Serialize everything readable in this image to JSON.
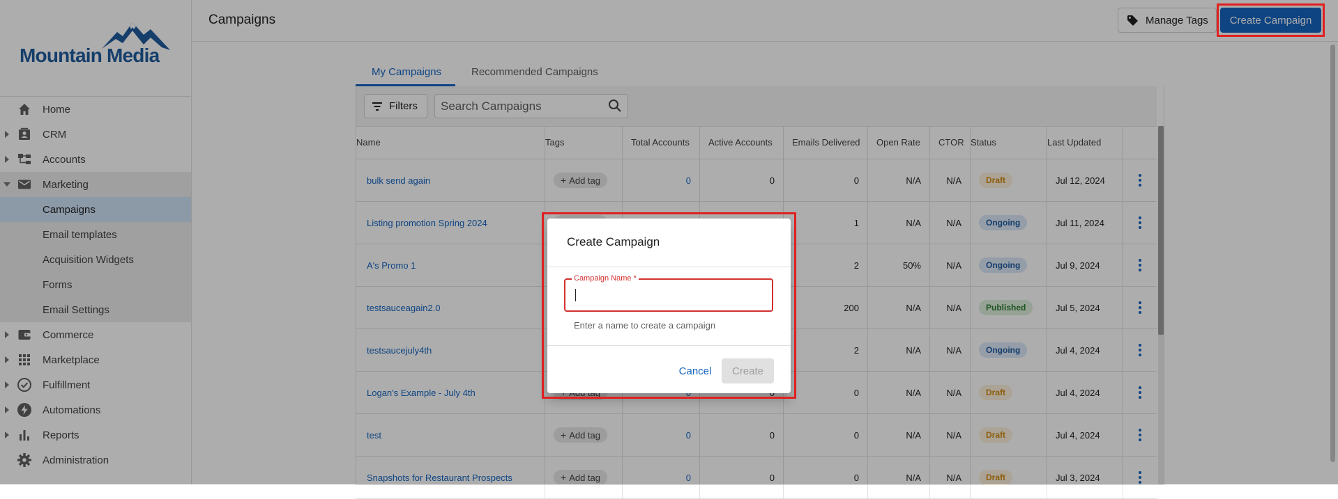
{
  "brand": {
    "logo_text": "Mountain Media",
    "color": "#1f5c9e"
  },
  "sidebar": {
    "items": [
      {
        "label": "Home",
        "icon": "home-icon"
      },
      {
        "label": "CRM",
        "icon": "contact-card-icon"
      },
      {
        "label": "Accounts",
        "icon": "accounts-tree-icon"
      },
      {
        "label": "Marketing",
        "icon": "mail-icon"
      },
      {
        "label": "Commerce",
        "icon": "wallet-icon"
      },
      {
        "label": "Marketplace",
        "icon": "grid-icon"
      },
      {
        "label": "Fulfillment",
        "icon": "check-circle-icon"
      },
      {
        "label": "Automations",
        "icon": "bolt-icon"
      },
      {
        "label": "Reports",
        "icon": "bar-chart-icon"
      },
      {
        "label": "Administration",
        "icon": "gear-icon"
      }
    ],
    "marketing_sub": [
      "Campaigns",
      "Email templates",
      "Acquisition Widgets",
      "Forms",
      "Email Settings"
    ]
  },
  "header": {
    "title": "Campaigns",
    "manage_tags": "Manage Tags",
    "create_campaign": "Create Campaign"
  },
  "tabs": [
    "My Campaigns",
    "Recommended Campaigns"
  ],
  "toolbar": {
    "filters": "Filters",
    "search_placeholder": "Search Campaigns"
  },
  "table": {
    "headers": [
      "Name",
      "Tags",
      "Total Accounts",
      "Active Accounts",
      "Emails Delivered",
      "Open Rate",
      "CTOR",
      "Status",
      "Last Updated"
    ],
    "add_tag_label": "Add tag",
    "rows": [
      {
        "name": "bulk send again",
        "total": "0",
        "active": "0",
        "emails": "0",
        "open": "N/A",
        "ctor": "N/A",
        "status": "Draft",
        "updated": "Jul 12, 2024"
      },
      {
        "name": "Listing promotion Spring 2024",
        "total": "",
        "active": "",
        "emails": "1",
        "open": "N/A",
        "ctor": "N/A",
        "status": "Ongoing",
        "updated": "Jul 11, 2024"
      },
      {
        "name": "A's Promo 1",
        "total": "",
        "active": "",
        "emails": "2",
        "open": "50%",
        "ctor": "N/A",
        "status": "Ongoing",
        "updated": "Jul 9, 2024"
      },
      {
        "name": "testsauceagain2.0",
        "total": "",
        "active": "",
        "emails": "200",
        "open": "N/A",
        "ctor": "N/A",
        "status": "Published",
        "updated": "Jul 5, 2024"
      },
      {
        "name": "testsaucejuly4th",
        "total": "",
        "active": "",
        "emails": "2",
        "open": "N/A",
        "ctor": "N/A",
        "status": "Ongoing",
        "updated": "Jul 4, 2024"
      },
      {
        "name": "Logan's Example - July 4th",
        "total": "0",
        "active": "0",
        "emails": "0",
        "open": "N/A",
        "ctor": "N/A",
        "status": "Draft",
        "updated": "Jul 4, 2024"
      },
      {
        "name": "test",
        "total": "0",
        "active": "0",
        "emails": "0",
        "open": "N/A",
        "ctor": "N/A",
        "status": "Draft",
        "updated": "Jul 4, 2024"
      },
      {
        "name": "Snapshots for Restaurant Prospects",
        "total": "0",
        "active": "0",
        "emails": "0",
        "open": "N/A",
        "ctor": "N/A",
        "status": "Draft",
        "updated": "Jul 3, 2024"
      }
    ]
  },
  "status_colors": {
    "Draft": {
      "bg": "#fdf1dc",
      "fg": "#d08a12"
    },
    "Ongoing": {
      "bg": "#dbe8f8",
      "fg": "#1f5c9e"
    },
    "Published": {
      "bg": "#dcefdc",
      "fg": "#2e7d32"
    }
  },
  "dialog": {
    "title": "Create Campaign",
    "field_label": "Campaign Name *",
    "field_value": "",
    "hint": "Enter a name to create a campaign",
    "cancel": "Cancel",
    "create": "Create"
  },
  "accent_color": "#1565c0",
  "highlight_color": "#e02020"
}
